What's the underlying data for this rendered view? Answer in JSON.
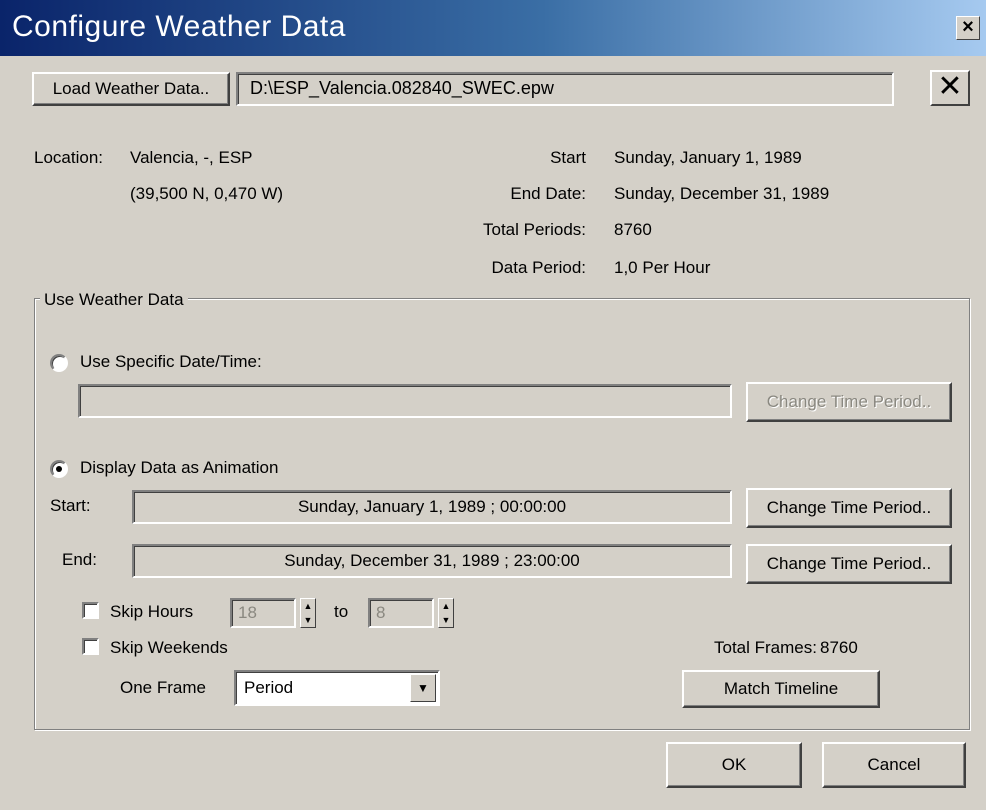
{
  "window": {
    "title": "Configure Weather Data",
    "close_glyph": "×"
  },
  "file": {
    "load_button": "Load Weather Data..",
    "path": "D:\\ESP_Valencia.082840_SWEC.epw",
    "clear_glyph": "✕"
  },
  "info": {
    "location_label": "Location:",
    "location_value": "Valencia, -, ESP",
    "coordinates": "(39,500 N, 0,470 W)",
    "start_label": "Start",
    "start_value": "Sunday, January 1, 1989",
    "end_label": "End Date:",
    "end_value": "Sunday, December 31, 1989",
    "total_periods_label": "Total Periods:",
    "total_periods_value": "8760",
    "data_period_label": "Data Period:",
    "data_period_value": "1,0 Per Hour"
  },
  "use_weather": {
    "group_title": "Use Weather Data",
    "specific_label": "Use Specific Date/Time:",
    "specific_value": "",
    "specific_change_button": "Change Time Period..",
    "animation_label": "Display Data as  Animation",
    "start_label": "Start:",
    "start_value": "Sunday, January 1, 1989 ; 00:00:00",
    "start_change_button": "Change Time Period..",
    "end_label": "End:",
    "end_value": "Sunday, December 31, 1989 ; 23:00:00",
    "end_change_button": "Change Time Period..",
    "skip_hours_label": "Skip Hours",
    "skip_hours_from": "18",
    "skip_to_label": "to",
    "skip_hours_to": "8",
    "skip_weekends_label": "Skip Weekends",
    "one_frame_label": "One Frame",
    "one_frame_value": "Period",
    "total_frames_label": "Total Frames:",
    "total_frames_value": "8760",
    "match_timeline_button": "Match Timeline",
    "selected_mode": "animation"
  },
  "footer": {
    "ok": "OK",
    "cancel": "Cancel"
  }
}
